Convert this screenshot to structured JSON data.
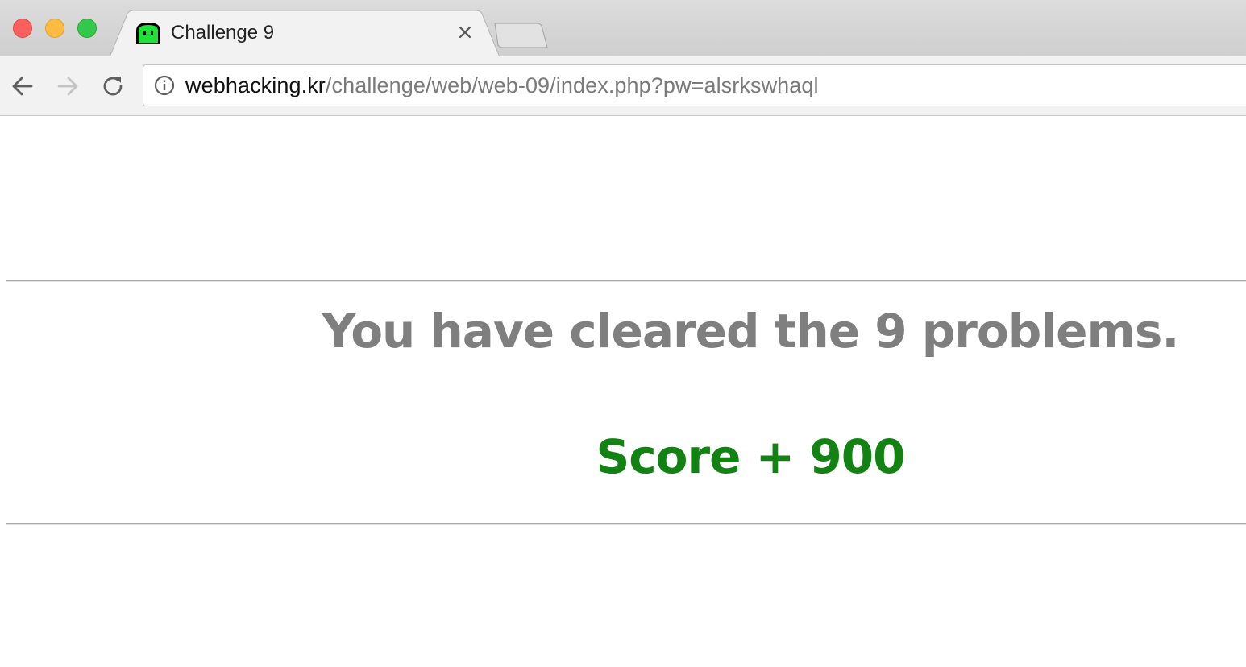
{
  "browser": {
    "window_controls": {
      "close_color": "#fc605c",
      "minimize_color": "#fdbc40",
      "maximize_color": "#34c84a"
    },
    "tab": {
      "title": "Challenge 9",
      "favicon": "green-ghost-icon",
      "close_icon": "close-icon"
    },
    "new_tab_icon": "new-tab-icon",
    "nav": {
      "back_icon": "back-arrow-icon",
      "forward_icon": "forward-arrow-icon",
      "reload_icon": "reload-icon"
    },
    "address_bar": {
      "info_icon": "info-icon",
      "host": "webhacking.kr",
      "path": "/challenge/web/web-09/index.php?pw=alsrkswhaql"
    }
  },
  "page": {
    "message": "You have cleared the 9 problems.",
    "score": "Score + 900",
    "message_color": "#7f7f7f",
    "score_color": "#128212"
  }
}
